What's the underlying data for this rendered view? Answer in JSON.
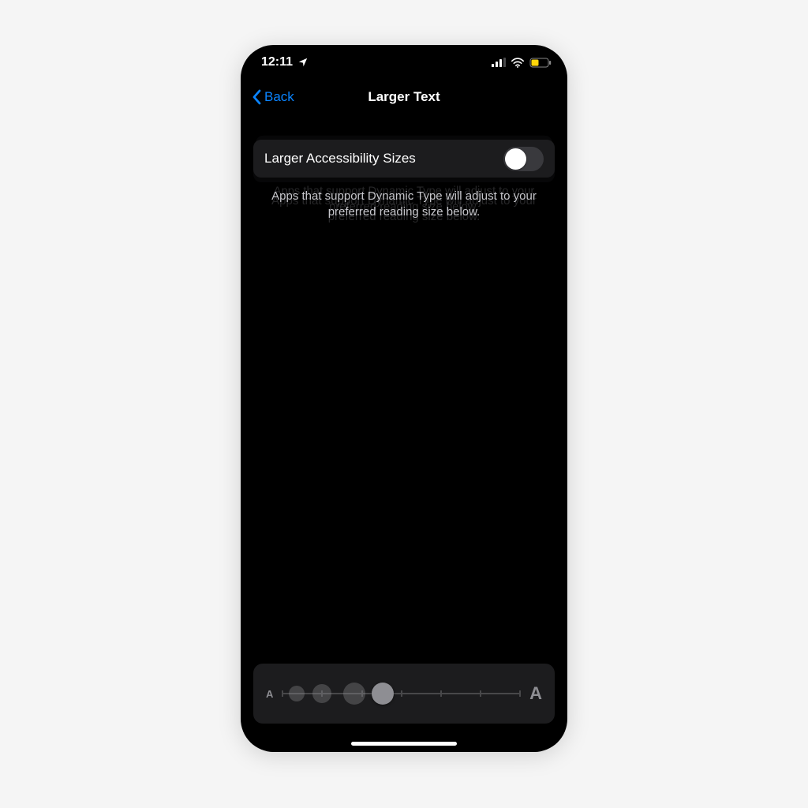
{
  "status": {
    "time": "12:11",
    "location_icon": "location-arrow"
  },
  "nav": {
    "back_label": "Back",
    "title": "Larger Text"
  },
  "row": {
    "label": "Larger Accessibility Sizes",
    "value": false
  },
  "caption": "Apps that support Dynamic Type will adjust to your preferred reading size below.",
  "slider": {
    "min_label": "A",
    "max_label": "A",
    "steps": 7,
    "value_index": 3
  },
  "colors": {
    "accent": "#0a84ff",
    "battery_fill": "#ffd60a"
  }
}
